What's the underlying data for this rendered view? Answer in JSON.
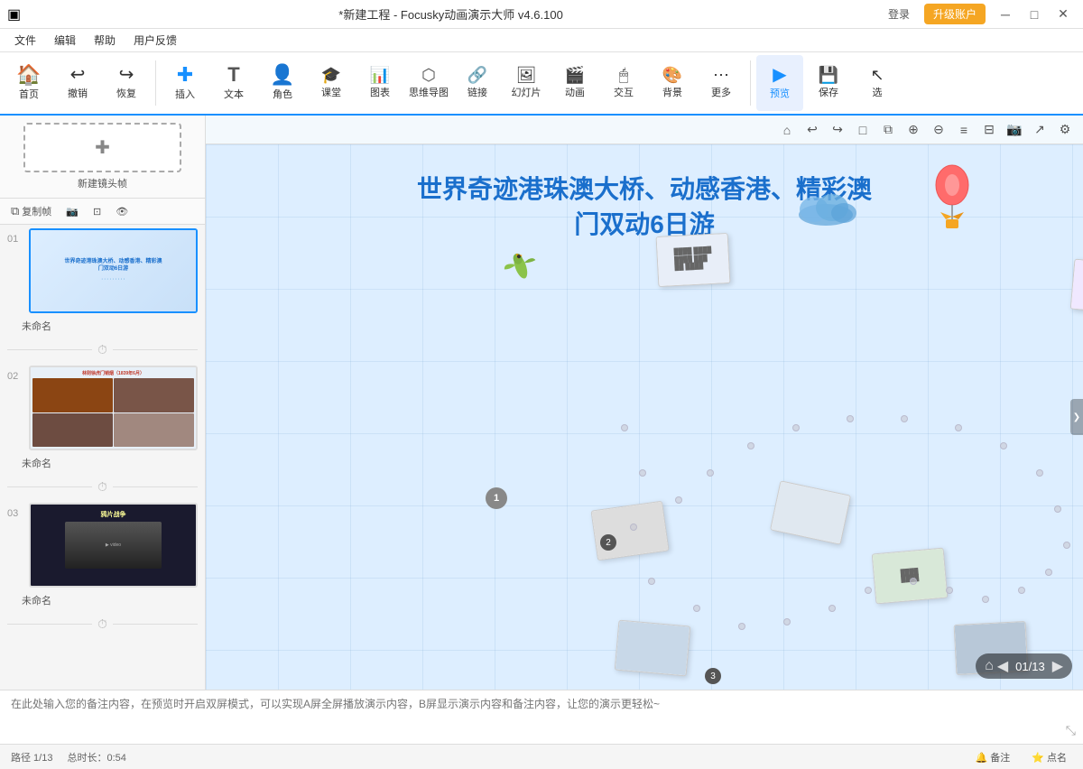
{
  "titlebar": {
    "icon": "▣",
    "title": "*新建工程 - Focusky动画演示大师 v4.6.100",
    "login_label": "登录",
    "upgrade_label": "升级账户",
    "min_btn": "─",
    "max_btn": "□",
    "close_btn": "✕"
  },
  "menubar": {
    "items": [
      "文件",
      "编辑",
      "帮助",
      "用户反馈"
    ]
  },
  "toolbar": {
    "items": [
      {
        "id": "home",
        "icon": "🏠",
        "label": "首页"
      },
      {
        "id": "undo",
        "icon": "↩",
        "label": "撤销"
      },
      {
        "id": "redo",
        "icon": "↪",
        "label": "恢复"
      },
      {
        "sep": true
      },
      {
        "id": "insert",
        "icon": "✚",
        "label": "插入"
      },
      {
        "id": "text",
        "icon": "T",
        "label": "文本"
      },
      {
        "id": "role",
        "icon": "👤",
        "label": "角色"
      },
      {
        "id": "class",
        "icon": "🎓",
        "label": "课堂"
      },
      {
        "id": "chart",
        "icon": "📊",
        "label": "图表"
      },
      {
        "id": "mindmap",
        "icon": "🔀",
        "label": "思维导图"
      },
      {
        "id": "link",
        "icon": "🔗",
        "label": "链接"
      },
      {
        "id": "slide",
        "icon": "▶",
        "label": "幻灯片"
      },
      {
        "id": "anim",
        "icon": "🎬",
        "label": "动画"
      },
      {
        "id": "interact",
        "icon": "🖱",
        "label": "交互"
      },
      {
        "id": "bg",
        "icon": "🖼",
        "label": "背景"
      },
      {
        "id": "more",
        "icon": "⋯",
        "label": "更多"
      },
      {
        "sep2": true
      },
      {
        "id": "preview",
        "icon": "▶",
        "label": "预览"
      },
      {
        "id": "save",
        "icon": "💾",
        "label": "保存"
      },
      {
        "id": "select",
        "icon": "↖",
        "label": "选"
      }
    ]
  },
  "slide_panel": {
    "new_frame_label": "新建镜头帧",
    "copy_btn": "复制帧",
    "camera_btn": "📷",
    "fit_btn": "⊡",
    "eye_btn": "👁",
    "slides": [
      {
        "num": "01",
        "name": "未命名",
        "type": "travel"
      },
      {
        "num": "02",
        "name": "未命名",
        "type": "opium"
      },
      {
        "num": "03",
        "name": "未命名",
        "type": "war"
      }
    ]
  },
  "canvas": {
    "main_title_line1": "世界奇迹港珠澳大桥、动感香港、精彩澳",
    "main_title_line2": "门双动6日游",
    "frame_badge": "1",
    "nav_prev": "◀",
    "nav_current": "01/13",
    "nav_next": "▶",
    "nav_home": "⌂",
    "collapse_right": "❯"
  },
  "notes": {
    "placeholder": "在此处输入您的备注内容，在预览时开启双屏模式，可以实现A屏全屏播放演示内容，B屏显示演示内容和备注内容，让您的演示更轻松~",
    "expand_icon": "⤡"
  },
  "statusbar": {
    "path": "路径 1/13",
    "duration": "总时长：0:54",
    "notes_btn": "🔔 备注",
    "points_btn": "⭐ 点名"
  },
  "canvas_tools": [
    {
      "icon": "⌂",
      "name": "home-canvas-icon"
    },
    {
      "icon": "↩",
      "name": "undo-canvas-icon"
    },
    {
      "icon": "↪",
      "name": "redo-canvas-icon"
    },
    {
      "icon": "□",
      "name": "copy-canvas-icon"
    },
    {
      "icon": "⧉",
      "name": "duplicate-canvas-icon"
    },
    {
      "icon": "⊕",
      "name": "zoom-in-icon"
    },
    {
      "icon": "⊖",
      "name": "zoom-out-icon"
    },
    {
      "icon": "≡",
      "name": "align-icon"
    },
    {
      "icon": "⊟",
      "name": "group-icon"
    },
    {
      "icon": "📷",
      "name": "screenshot-icon"
    },
    {
      "icon": "↗",
      "name": "export-icon"
    },
    {
      "icon": "⚙",
      "name": "settings-canvas-icon"
    }
  ]
}
